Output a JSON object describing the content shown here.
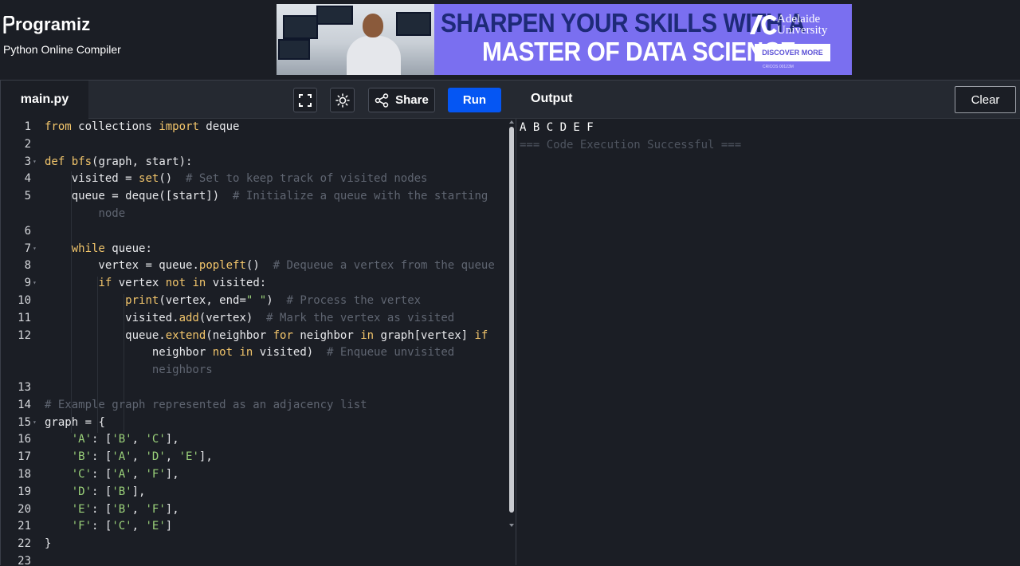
{
  "brand": {
    "logo_text": "rogramiz",
    "subtitle": "Python Online Compiler"
  },
  "ad": {
    "headline_1": "SHARPEN YOUR SKILLS WITH A",
    "headline_2": "MASTER OF DATA SCIENCE",
    "university_1": "Adelaide",
    "university_2": "University",
    "cta": "DISCOVER MORE",
    "fine_print": "CRICOS 00123M"
  },
  "editor": {
    "file_tab": "main.py",
    "share_label": "Share",
    "run_label": "Run",
    "lines": [
      {
        "n": "1",
        "fold": false,
        "html": "<span class='k'>from</span> collections <span class='k'>import</span> deque"
      },
      {
        "n": "2",
        "fold": false,
        "html": ""
      },
      {
        "n": "3",
        "fold": true,
        "html": "<span class='k'>def</span> <span class='f'>bfs</span>(graph, start):"
      },
      {
        "n": "4",
        "fold": false,
        "html": "    visited <span class='o'>=</span> <span class='f'>set</span>()  <span class='c'># Set to keep track of visited nodes</span>"
      },
      {
        "n": "5",
        "fold": false,
        "html": "    queue <span class='o'>=</span> deque([start])  <span class='c'># Initialize a queue with the starting</span>"
      },
      {
        "n": "",
        "fold": false,
        "html": "        <span class='c'>node</span>"
      },
      {
        "n": "6",
        "fold": false,
        "html": ""
      },
      {
        "n": "7",
        "fold": true,
        "html": "    <span class='k'>while</span> queue:"
      },
      {
        "n": "8",
        "fold": false,
        "html": "        vertex <span class='o'>=</span> queue.<span class='f'>popleft</span>()  <span class='c'># Dequeue a vertex from the queue</span>"
      },
      {
        "n": "9",
        "fold": true,
        "html": "        <span class='k'>if</span> vertex <span class='k'>not</span> <span class='k'>in</span> visited:"
      },
      {
        "n": "10",
        "fold": false,
        "html": "            <span class='f'>print</span>(vertex, end<span class='o'>=</span><span class='s'>\" \"</span>)  <span class='c'># Process the vertex</span>"
      },
      {
        "n": "11",
        "fold": false,
        "html": "            visited.<span class='f'>add</span>(vertex)  <span class='c'># Mark the vertex as visited</span>"
      },
      {
        "n": "12",
        "fold": false,
        "html": "            queue.<span class='f'>extend</span>(neighbor <span class='k'>for</span> neighbor <span class='k'>in</span> graph[vertex] <span class='k'>if</span>"
      },
      {
        "n": "",
        "fold": false,
        "html": "                neighbor <span class='k'>not</span> <span class='k'>in</span> visited)  <span class='c'># Enqueue unvisited</span>"
      },
      {
        "n": "",
        "fold": false,
        "html": "                <span class='c'>neighbors</span>"
      },
      {
        "n": "13",
        "fold": false,
        "html": ""
      },
      {
        "n": "14",
        "fold": false,
        "html": "<span class='c'># Example graph represented as an adjacency list</span>"
      },
      {
        "n": "15",
        "fold": true,
        "html": "graph <span class='o'>=</span> {"
      },
      {
        "n": "16",
        "fold": false,
        "html": "    <span class='s'>'A'</span>: [<span class='s'>'B'</span>, <span class='s'>'C'</span>],"
      },
      {
        "n": "17",
        "fold": false,
        "html": "    <span class='s'>'B'</span>: [<span class='s'>'A'</span>, <span class='s'>'D'</span>, <span class='s'>'E'</span>],"
      },
      {
        "n": "18",
        "fold": false,
        "html": "    <span class='s'>'C'</span>: [<span class='s'>'A'</span>, <span class='s'>'F'</span>],"
      },
      {
        "n": "19",
        "fold": false,
        "html": "    <span class='s'>'D'</span>: [<span class='s'>'B'</span>],"
      },
      {
        "n": "20",
        "fold": false,
        "html": "    <span class='s'>'E'</span>: [<span class='s'>'B'</span>, <span class='s'>'F'</span>],"
      },
      {
        "n": "21",
        "fold": false,
        "html": "    <span class='s'>'F'</span>: [<span class='s'>'C'</span>, <span class='s'>'E'</span>]"
      },
      {
        "n": "22",
        "fold": false,
        "html": "}"
      },
      {
        "n": "23",
        "fold": false,
        "html": ""
      }
    ]
  },
  "output": {
    "title": "Output",
    "clear_label": "Clear",
    "result": "A B C D E F",
    "status": "=== Code Execution Successful ==="
  },
  "colors": {
    "run_button": "#0556f3",
    "keyword": "#f2c56b",
    "string": "#9bd27a",
    "comment": "#5f6571"
  }
}
